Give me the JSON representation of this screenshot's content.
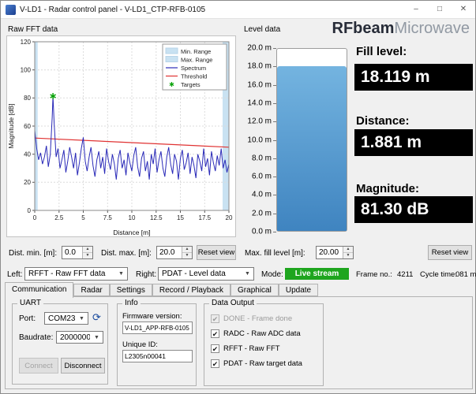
{
  "window": {
    "title": "V-LD1 - Radar control panel - V-LD1_CTP-RFB-0105",
    "minimize": "–",
    "maximize": "□",
    "close": "✕"
  },
  "brand": {
    "bold": "RFbeam",
    "light": "Microwave"
  },
  "fft": {
    "section_title": "Raw FFT data",
    "dist_min_label": "Dist. min. [m]:",
    "dist_min": "0.0",
    "dist_max_label": "Dist. max. [m]:",
    "dist_max": "20.0",
    "reset": "Reset view"
  },
  "level": {
    "section_title": "Level data",
    "fill_label": "Fill level:",
    "fill_value": "18.119 m",
    "distance_label": "Distance:",
    "distance_value": "1.881 m",
    "magnitude_label": "Magnitude:",
    "magnitude_value": "81.30 dB",
    "max_fill_label": "Max. fill level [m]:",
    "max_fill": "20.00",
    "reset": "Reset view",
    "gauge": {
      "max": 20,
      "value": 18.119,
      "tick_labels": [
        "20.0 m",
        "18.0 m",
        "16.0 m",
        "14.0 m",
        "12.0 m",
        "10.0 m",
        "8.0 m",
        "6.0 m",
        "4.0 m",
        "2.0 m",
        "0.0 m"
      ]
    }
  },
  "streambar": {
    "left_label": "Left:",
    "left_value": "RFFT - Raw FFT data",
    "right_label": "Right:",
    "right_value": "PDAT - Level data",
    "mode_label": "Mode:",
    "mode_value": "Live stream",
    "mode_color": "#1ea51e",
    "frame_label": "Frame no.:",
    "frame_value": "4211",
    "cycle_label": "Cycle time:",
    "cycle_value": "081 ms"
  },
  "tabs": {
    "items": [
      "Communication",
      "Radar",
      "Settings",
      "Record / Playback",
      "Graphical",
      "Update"
    ],
    "active": 0
  },
  "uart": {
    "title": "UART",
    "port_label": "Port:",
    "port_value": "COM23",
    "baud_label": "Baudrate:",
    "baud_value": "2000000",
    "connect": "Connect",
    "disconnect": "Disconnect"
  },
  "info": {
    "title": "Info",
    "fw_label": "Firmware version:",
    "fw_value": "V-LD1_APP-RFB-0105",
    "uid_label": "Unique ID:",
    "uid_value": "L2305n00041"
  },
  "output": {
    "title": "Data Output",
    "items": [
      {
        "label": "DONE - Frame done",
        "checked": true,
        "disabled": true
      },
      {
        "label": "RADC - Raw ADC data",
        "checked": true,
        "disabled": false
      },
      {
        "label": "RFFT - Raw FFT",
        "checked": true,
        "disabled": false
      },
      {
        "label": "PDAT - Raw target data",
        "checked": true,
        "disabled": false
      }
    ]
  },
  "chart_data": {
    "type": "line",
    "title": "",
    "xlabel": "Distance [m]",
    "ylabel": "Magnitude [dB]",
    "xlim": [
      0,
      20
    ],
    "ylim": [
      0,
      120
    ],
    "xticks": [
      0,
      2.5,
      5,
      7.5,
      10,
      12.5,
      15,
      17.5,
      20
    ],
    "yticks": [
      0,
      20,
      40,
      60,
      80,
      100,
      120
    ],
    "legend": [
      "Min. Range",
      "Max. Range",
      "Spectrum",
      "Threshold",
      "Targets"
    ],
    "legend_position": "upper right",
    "grid": true,
    "min_range": [
      0,
      0.3
    ],
    "max_range": [
      19.35,
      20
    ],
    "threshold": {
      "x": [
        0,
        20
      ],
      "y": [
        51.5,
        45
      ]
    },
    "targets": [
      {
        "x": 1.881,
        "y": 81.3
      }
    ],
    "colors": {
      "spectrum": "#2a2ab8",
      "threshold": "#e03232",
      "range": "#c9e2f2",
      "target": "#00a000"
    },
    "series": [
      {
        "name": "Spectrum",
        "points": [
          [
            0,
            57
          ],
          [
            0.2,
            44
          ],
          [
            0.4,
            36
          ],
          [
            0.6,
            41
          ],
          [
            0.8,
            33
          ],
          [
            1,
            38
          ],
          [
            1.2,
            46
          ],
          [
            1.4,
            31
          ],
          [
            1.6,
            40
          ],
          [
            1.8,
            66
          ],
          [
            1.881,
            81.3
          ],
          [
            2,
            62
          ],
          [
            2.2,
            38
          ],
          [
            2.4,
            44
          ],
          [
            2.6,
            30
          ],
          [
            2.8,
            36
          ],
          [
            3,
            43
          ],
          [
            3.2,
            27
          ],
          [
            3.4,
            35
          ],
          [
            3.6,
            45
          ],
          [
            3.8,
            38
          ],
          [
            4,
            30
          ],
          [
            4.2,
            41
          ],
          [
            4.4,
            25
          ],
          [
            4.6,
            34
          ],
          [
            4.8,
            44
          ],
          [
            5,
            52
          ],
          [
            5.2,
            35
          ],
          [
            5.4,
            28
          ],
          [
            5.6,
            38
          ],
          [
            5.8,
            45
          ],
          [
            6,
            32
          ],
          [
            6.2,
            24
          ],
          [
            6.4,
            36
          ],
          [
            6.6,
            42
          ],
          [
            6.8,
            30
          ],
          [
            7,
            38
          ],
          [
            7.2,
            26
          ],
          [
            7.4,
            44
          ],
          [
            7.6,
            35
          ],
          [
            7.8,
            29
          ],
          [
            8,
            40
          ],
          [
            8.2,
            33
          ],
          [
            8.4,
            22
          ],
          [
            8.6,
            37
          ],
          [
            8.8,
            43
          ],
          [
            9,
            30
          ],
          [
            9.2,
            36
          ],
          [
            9.4,
            25
          ],
          [
            9.6,
            41
          ],
          [
            9.8,
            34
          ],
          [
            10,
            28
          ],
          [
            10.2,
            39
          ],
          [
            10.4,
            45
          ],
          [
            10.6,
            31
          ],
          [
            10.8,
            24
          ],
          [
            11,
            37
          ],
          [
            11.2,
            42
          ],
          [
            11.4,
            28
          ],
          [
            11.6,
            35
          ],
          [
            11.8,
            22
          ],
          [
            12,
            40
          ],
          [
            12.2,
            33
          ],
          [
            12.4,
            44
          ],
          [
            12.6,
            27
          ],
          [
            12.8,
            36
          ],
          [
            13,
            42
          ],
          [
            13.2,
            30
          ],
          [
            13.4,
            24
          ],
          [
            13.6,
            38
          ],
          [
            13.8,
            45
          ],
          [
            14,
            33
          ],
          [
            14.2,
            26
          ],
          [
            14.4,
            40
          ],
          [
            14.6,
            35
          ],
          [
            14.8,
            22
          ],
          [
            15,
            37
          ],
          [
            15.2,
            43
          ],
          [
            15.4,
            29
          ],
          [
            15.6,
            34
          ],
          [
            15.8,
            41
          ],
          [
            16,
            26
          ],
          [
            16.2,
            38
          ],
          [
            16.4,
            32
          ],
          [
            16.6,
            23
          ],
          [
            16.8,
            40
          ],
          [
            17,
            35
          ],
          [
            17.2,
            28
          ],
          [
            17.4,
            44
          ],
          [
            17.6,
            31
          ],
          [
            17.8,
            37
          ],
          [
            18,
            25
          ],
          [
            18.2,
            42
          ],
          [
            18.4,
            34
          ],
          [
            18.6,
            28
          ],
          [
            18.8,
            39
          ],
          [
            19,
            32
          ],
          [
            19.2,
            44
          ],
          [
            19.4,
            30
          ],
          [
            19.6,
            36
          ],
          [
            19.8,
            27
          ],
          [
            20,
            33
          ]
        ]
      }
    ]
  }
}
